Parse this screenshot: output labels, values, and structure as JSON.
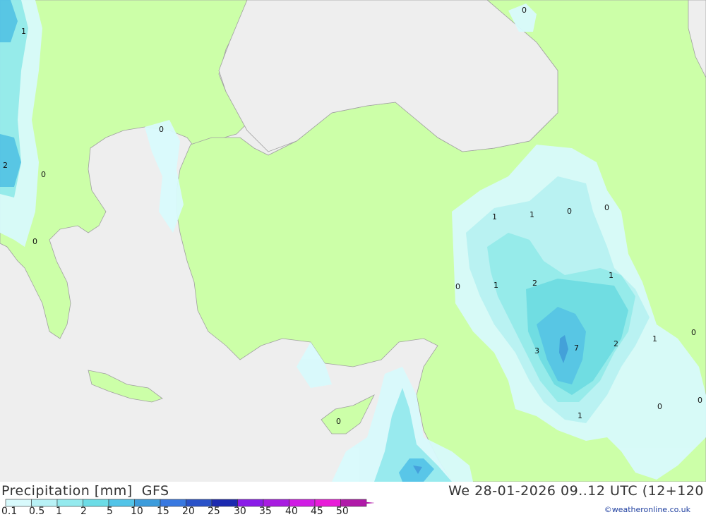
{
  "header": {
    "title_left": "Precipitation [mm]  GFS",
    "title_right": "We 28-01-2026 09..12 UTC (12+120"
  },
  "legend": {
    "labels": [
      "0.1",
      "0.5",
      "1",
      "2",
      "5",
      "10",
      "15",
      "20",
      "25",
      "30",
      "35",
      "40",
      "45",
      "50"
    ],
    "colors": [
      "#d8fafc",
      "#b8f2f6",
      "#94eaee",
      "#6cdce6",
      "#52c4e8",
      "#3c9cdc",
      "#3878e0",
      "#2a52c8",
      "#1c2ab0",
      "#8a1ce8",
      "#a81ce0",
      "#d01ce4",
      "#e81cd8",
      "#b01aa8"
    ]
  },
  "map": {
    "value_labels": [
      "1",
      "0",
      "2",
      "0",
      "0",
      "0",
      "1",
      "1",
      "0",
      "0",
      "0",
      "1",
      "2",
      "1",
      "3",
      "7",
      "2",
      "1",
      "0",
      "0",
      "0",
      "1"
    ]
  },
  "colors": {
    "land": "#ccffa8",
    "sea": "#eeeeee",
    "border": "#a0a0a0"
  },
  "credit": "©weatheronline.co.uk"
}
